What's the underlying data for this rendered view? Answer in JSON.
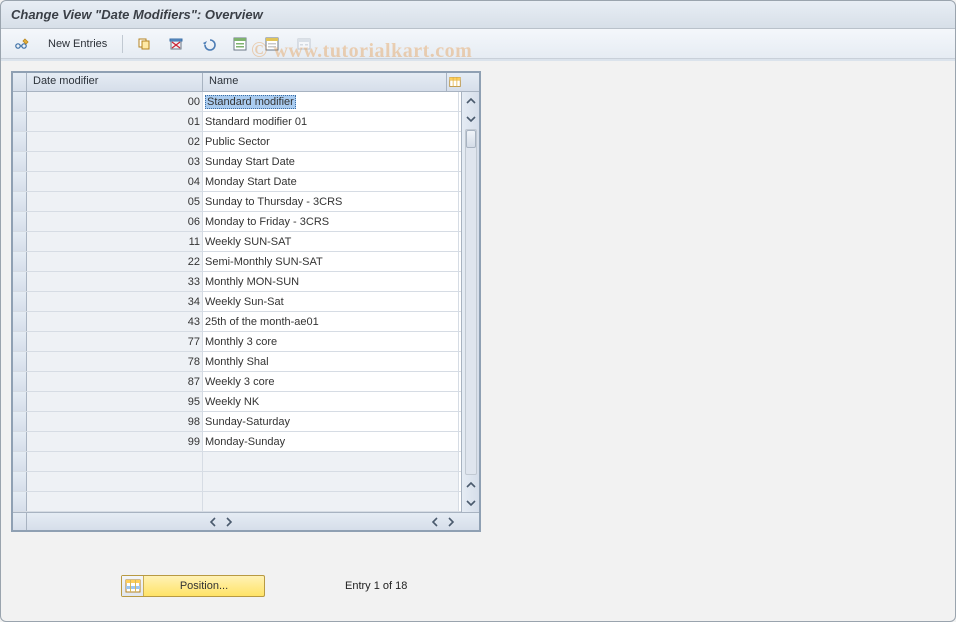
{
  "window": {
    "title": "Change View \"Date Modifiers\": Overview"
  },
  "toolbar": {
    "new_entries_label": "New Entries"
  },
  "watermark": {
    "copy": "©",
    "text": "www.tutorialkart.com"
  },
  "grid": {
    "columns": {
      "code": "Date modifier",
      "name": "Name"
    },
    "rows": [
      {
        "code": "00",
        "name": "Standard modifier",
        "selected": true
      },
      {
        "code": "01",
        "name": "Standard modifier 01"
      },
      {
        "code": "02",
        "name": "Public Sector"
      },
      {
        "code": "03",
        "name": "Sunday Start Date"
      },
      {
        "code": "04",
        "name": "Monday Start Date"
      },
      {
        "code": "05",
        "name": "Sunday to Thursday - 3CRS"
      },
      {
        "code": "06",
        "name": "Monday to Friday - 3CRS"
      },
      {
        "code": "11",
        "name": "Weekly SUN-SAT"
      },
      {
        "code": "22",
        "name": "Semi-Monthly SUN-SAT"
      },
      {
        "code": "33",
        "name": "Monthly MON-SUN"
      },
      {
        "code": "34",
        "name": "Weekly Sun-Sat"
      },
      {
        "code": "43",
        "name": "25th of the month-ae01"
      },
      {
        "code": "77",
        "name": "Monthly 3 core"
      },
      {
        "code": "78",
        "name": "Monthly Shal"
      },
      {
        "code": "87",
        "name": "Weekly 3 core"
      },
      {
        "code": "95",
        "name": "Weekly NK"
      },
      {
        "code": "98",
        "name": "Sunday-Saturday"
      },
      {
        "code": "99",
        "name": "Monday-Sunday"
      }
    ],
    "empty_rows": 3
  },
  "footer": {
    "position_label": "Position...",
    "entry_info": "Entry 1 of 18"
  }
}
